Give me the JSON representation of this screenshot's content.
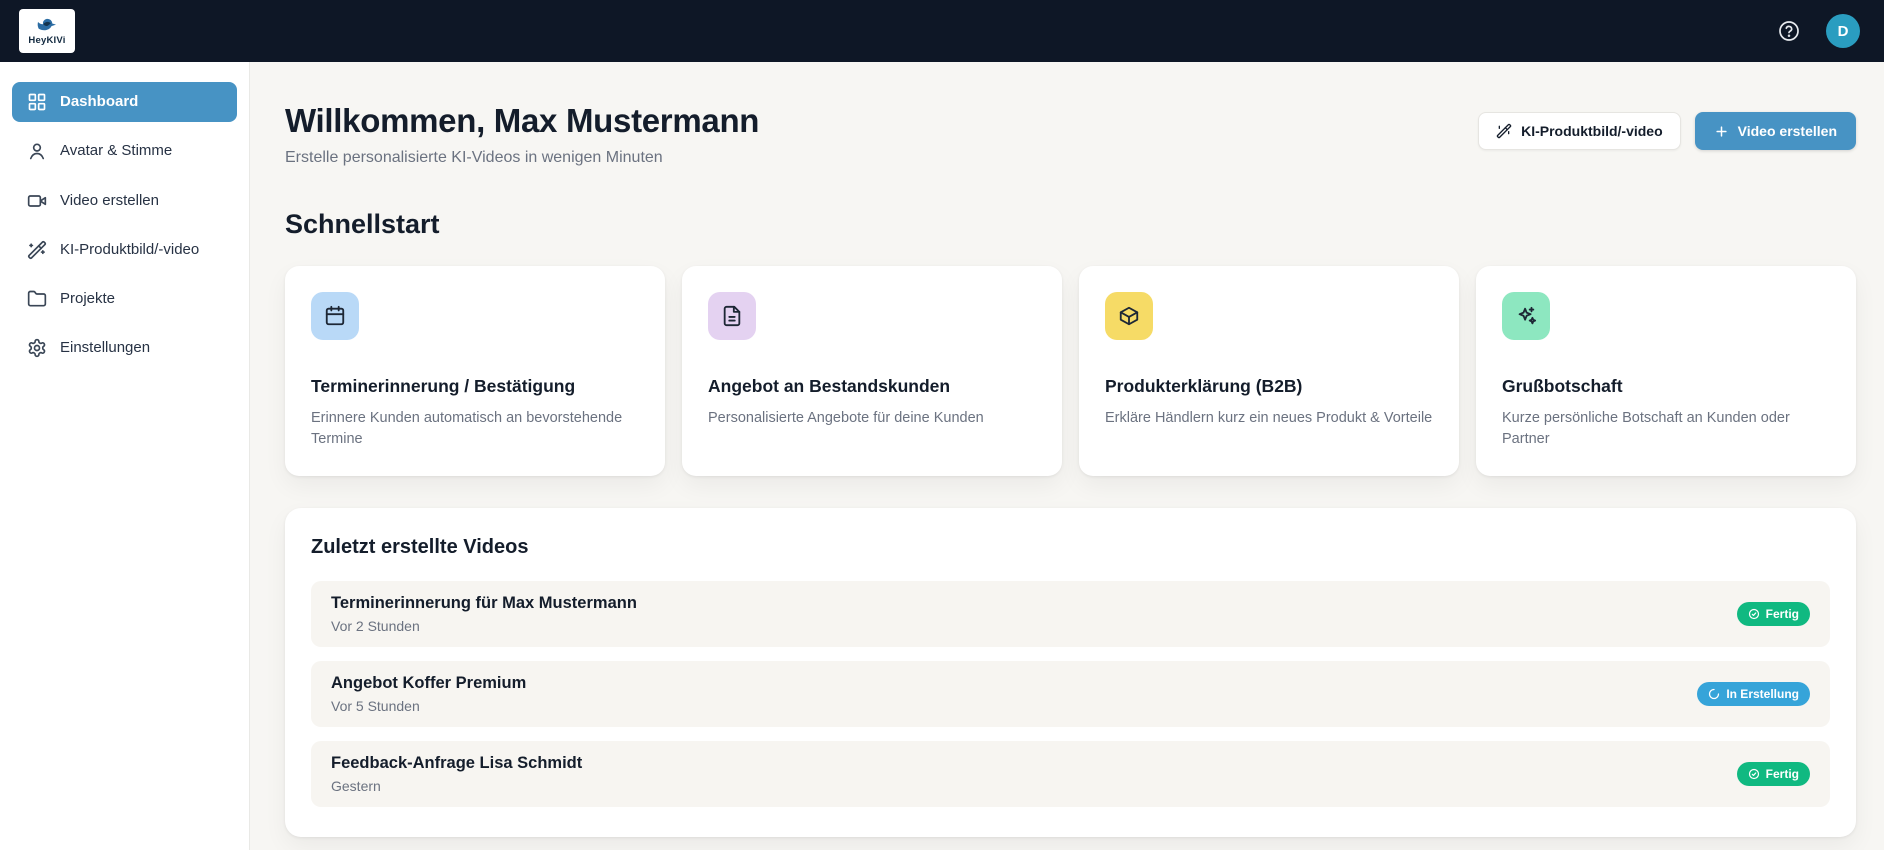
{
  "header": {
    "brand": "HeyKIVi",
    "avatar_initial": "D"
  },
  "sidebar": {
    "items": [
      {
        "label": "Dashboard"
      },
      {
        "label": "Avatar & Stimme"
      },
      {
        "label": "Video erstellen"
      },
      {
        "label": "KI-Produktbild/-video"
      },
      {
        "label": "Projekte"
      },
      {
        "label": "Einstellungen"
      }
    ]
  },
  "main": {
    "title": "Willkommen, Max Mustermann",
    "subtitle": "Erstelle personalisierte KI-Videos in wenigen Minuten",
    "actions": {
      "secondary_label": "KI-Produktbild/-video",
      "primary_label": "Video erstellen"
    },
    "quickstart": {
      "heading": "Schnellstart",
      "cards": [
        {
          "title": "Terminerinnerung / Bestätigung",
          "description": "Erinnere Kunden automatisch an bevorstehende Termine",
          "icon": "calendar-icon",
          "icon_bg": "#b9d9f7"
        },
        {
          "title": "Angebot an Bestandskunden",
          "description": "Personalisierte Angebote für deine Kunden",
          "icon": "document-icon",
          "icon_bg": "#e4d2f1"
        },
        {
          "title": "Produkterklärung (B2B)",
          "description": "Erkläre Händlern kurz ein neues Produkt & Vorteile",
          "icon": "package-icon",
          "icon_bg": "#f6db66"
        },
        {
          "title": "Grußbotschaft",
          "description": "Kurze persönliche Botschaft an Kunden oder Partner",
          "icon": "sparkles-icon",
          "icon_bg": "#8de7c0"
        }
      ]
    },
    "recent": {
      "heading": "Zuletzt erstellte Videos",
      "videos": [
        {
          "title": "Terminerinnerung für Max Mustermann",
          "time": "Vor 2 Stunden",
          "status": "Fertig",
          "status_type": "done"
        },
        {
          "title": "Angebot Koffer Premium",
          "time": "Vor 5 Stunden",
          "status": "In Erstellung",
          "status_type": "progress"
        },
        {
          "title": "Feedback-Anfrage Lisa Schmidt",
          "time": "Gestern",
          "status": "Fertig",
          "status_type": "done"
        }
      ]
    }
  },
  "colors": {
    "header_bg": "#0e1726",
    "accent_blue": "#4793c4",
    "badge_green": "#10b981",
    "badge_blue": "#36a4d9",
    "avatar_bg": "#2a9dc0"
  }
}
